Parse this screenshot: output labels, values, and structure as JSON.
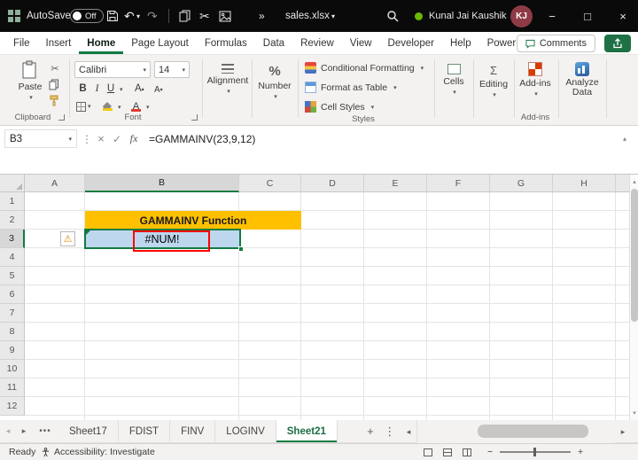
{
  "titlebar": {
    "autosave_label": "AutoSave",
    "autosave_state": "Off",
    "doc_name": "sales.xlsx",
    "user_name": "Kunal Jai Kaushik",
    "user_initials": "KJ"
  },
  "icons": {
    "dropdown": "▾",
    "undo": "↶",
    "redo": "↷",
    "cut": "✂",
    "overflow_chevron": "»",
    "more_vertical": "⋮",
    "cancel": "×",
    "confirm": "✓",
    "fx": "fx",
    "warning": "⚠",
    "minimize": "−",
    "maximize": "□",
    "close": "×",
    "up_arrow": "▴",
    "down_arrow": "▾",
    "left_arrow": "◂",
    "right_arrow": "▸",
    "plus": "+",
    "minus": "−",
    "ellipsis": "•••",
    "percent": "%",
    "bold": "B",
    "italic": "I",
    "underline": "U",
    "letter_a": "A",
    "sigma": "Σ"
  },
  "menubar": {
    "tabs": [
      "File",
      "Insert",
      "Home",
      "Page Layout",
      "Formulas",
      "Data",
      "Review",
      "View",
      "Developer",
      "Help",
      "Power Pivot"
    ],
    "active_tab": "Home",
    "comments_label": "Comments"
  },
  "ribbon": {
    "paste": "Paste",
    "clipboard_group": "Clipboard",
    "font_name": "Calibri",
    "font_size": "14",
    "font_group": "Font",
    "alignment": "Alignment",
    "number": "Number",
    "conditional_formatting": "Conditional Formatting",
    "format_as_table": "Format as Table",
    "cell_styles": "Cell Styles",
    "styles_group": "Styles",
    "cells": "Cells",
    "editing": "Editing",
    "addins": "Add-ins",
    "addins_group": "Add-ins",
    "analyze_data": "Analyze Data"
  },
  "formula_bar": {
    "name_box": "B3",
    "formula": "=GAMMAINV(23,9,12)"
  },
  "grid": {
    "columns": [
      "A",
      "B",
      "C",
      "D",
      "E",
      "F",
      "G",
      "H",
      ""
    ],
    "rows": [
      "1",
      "2",
      "3",
      "4",
      "5",
      "6",
      "7",
      "8",
      "9",
      "10",
      "11",
      "12"
    ],
    "selected_col": "B",
    "selected_row": "3",
    "selected_cell": "B3",
    "title_cell_text": "GAMMAINV Function",
    "error_cell_text": "#NUM!"
  },
  "sheet_tabs": {
    "tabs": [
      "Sheet17",
      "FDIST",
      "FINV",
      "LOGINV",
      "Sheet21"
    ],
    "active": "Sheet21"
  },
  "status_bar": {
    "ready": "Ready",
    "accessibility": "Accessibility: Investigate"
  },
  "colors": {
    "excel_green": "#107C41",
    "title_gold": "#FFC000",
    "cell_blue": "#BDD7EE",
    "annotation_red": "#FF0000",
    "avatar_maroon": "#8E3B46"
  }
}
